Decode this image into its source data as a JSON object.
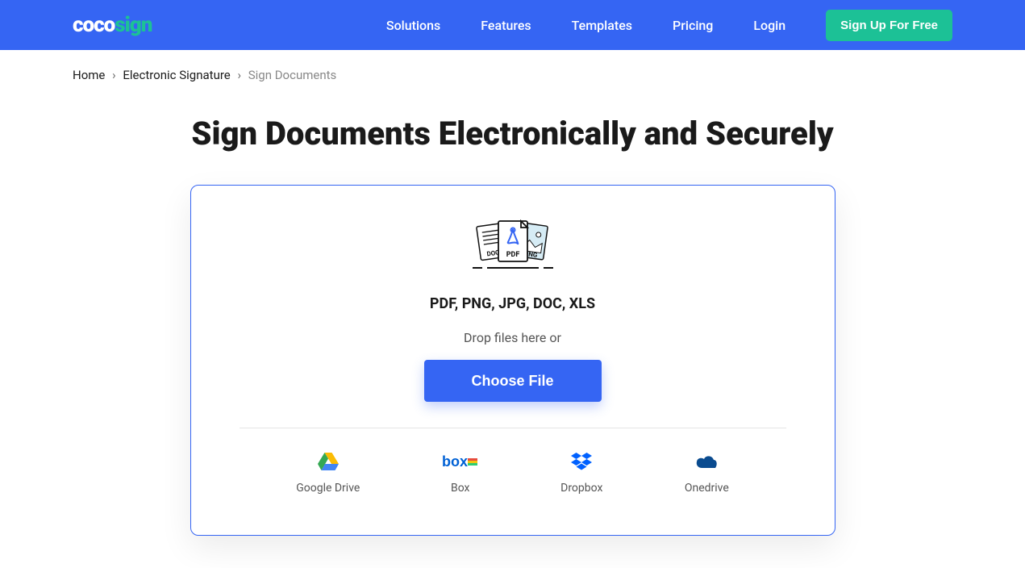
{
  "header": {
    "logo_part1": "coco",
    "logo_part2": "sign",
    "nav": {
      "solutions": "Solutions",
      "features": "Features",
      "templates": "Templates",
      "pricing": "Pricing",
      "login": "Login"
    },
    "signup_label": "Sign Up For Free"
  },
  "breadcrumb": {
    "home": "Home",
    "esig": "Electronic Signature",
    "current": "Sign Documents"
  },
  "hero": {
    "title": "Sign Documents Electronically and Securely"
  },
  "upload": {
    "formats": "PDF, PNG, JPG, DOC, XLS",
    "drop_text": "Drop files here or",
    "choose_label": "Choose File",
    "file_label_doc": "DOC",
    "file_label_pdf": "PDF",
    "file_label_png": "PNG"
  },
  "providers": {
    "gdrive": "Google Drive",
    "box": "Box",
    "dropbox": "Dropbox",
    "onedrive": "Onedrive"
  }
}
